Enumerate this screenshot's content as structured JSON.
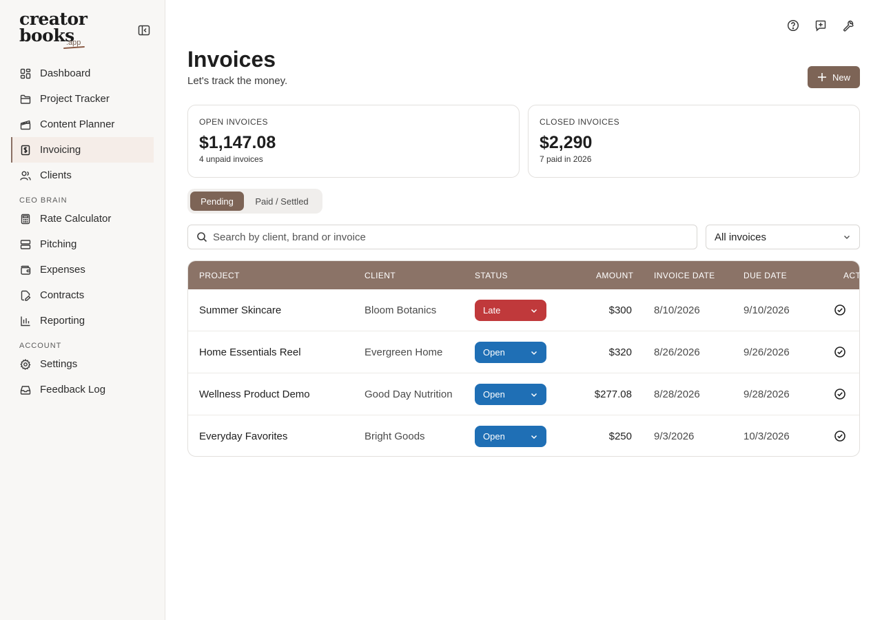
{
  "brand": {
    "line1": "creator",
    "line2": "books",
    "suffix": ".app"
  },
  "colors": {
    "accent": "#7d6456",
    "header": "#8b7367",
    "late": "#c0393b",
    "open": "#1f6fb5"
  },
  "sidebar": {
    "items": [
      {
        "label": "Dashboard",
        "icon": "dashboard-icon"
      },
      {
        "label": "Project Tracker",
        "icon": "folder-icon"
      },
      {
        "label": "Content Planner",
        "icon": "clapperboard-icon"
      },
      {
        "label": "Invoicing",
        "icon": "invoice-icon",
        "active": true
      },
      {
        "label": "Clients",
        "icon": "users-icon"
      }
    ],
    "section_ceo": "CEO BRAIN",
    "ceo_items": [
      {
        "label": "Rate Calculator",
        "icon": "calculator-icon"
      },
      {
        "label": "Pitching",
        "icon": "layers-icon"
      },
      {
        "label": "Expenses",
        "icon": "wallet-icon"
      },
      {
        "label": "Contracts",
        "icon": "contract-icon"
      },
      {
        "label": "Reporting",
        "icon": "bar-chart-icon"
      }
    ],
    "section_account": "ACCOUNT",
    "account_items": [
      {
        "label": "Settings",
        "icon": "gear-icon"
      },
      {
        "label": "Feedback Log",
        "icon": "inbox-icon"
      }
    ]
  },
  "header": {
    "title": "Invoices",
    "subtitle": "Let's track the money.",
    "new_label": "New"
  },
  "cards": {
    "open": {
      "label": "OPEN INVOICES",
      "value": "$1,147.08",
      "sub": "4 unpaid invoices"
    },
    "closed": {
      "label": "CLOSED INVOICES",
      "value": "$2,290",
      "sub": "7 paid in 2026"
    }
  },
  "tabs": {
    "pending": "Pending",
    "paid": "Paid / Settled"
  },
  "search": {
    "placeholder": "Search by client, brand or invoice"
  },
  "filter": {
    "selected": "All invoices"
  },
  "table": {
    "columns": {
      "project": "PROJECT",
      "client": "CLIENT",
      "status": "STATUS",
      "amount": "AMOUNT",
      "invoice_date": "INVOICE DATE",
      "due_date": "DUE DATE",
      "actions": "ACTIONS"
    },
    "rows": [
      {
        "project": "Summer Skincare",
        "client": "Bloom Botanics",
        "status": "Late",
        "amount": "$300",
        "invoice_date": "8/10/2026",
        "due_date": "9/10/2026"
      },
      {
        "project": "Home Essentials Reel",
        "client": "Evergreen Home",
        "status": "Open",
        "amount": "$320",
        "invoice_date": "8/26/2026",
        "due_date": "9/26/2026"
      },
      {
        "project": "Wellness Product Demo",
        "client": "Good Day Nutrition",
        "status": "Open",
        "amount": "$277.08",
        "invoice_date": "8/28/2026",
        "due_date": "9/28/2026"
      },
      {
        "project": "Everyday Favorites",
        "client": "Bright Goods",
        "status": "Open",
        "amount": "$250",
        "invoice_date": "9/3/2026",
        "due_date": "10/3/2026"
      }
    ]
  }
}
